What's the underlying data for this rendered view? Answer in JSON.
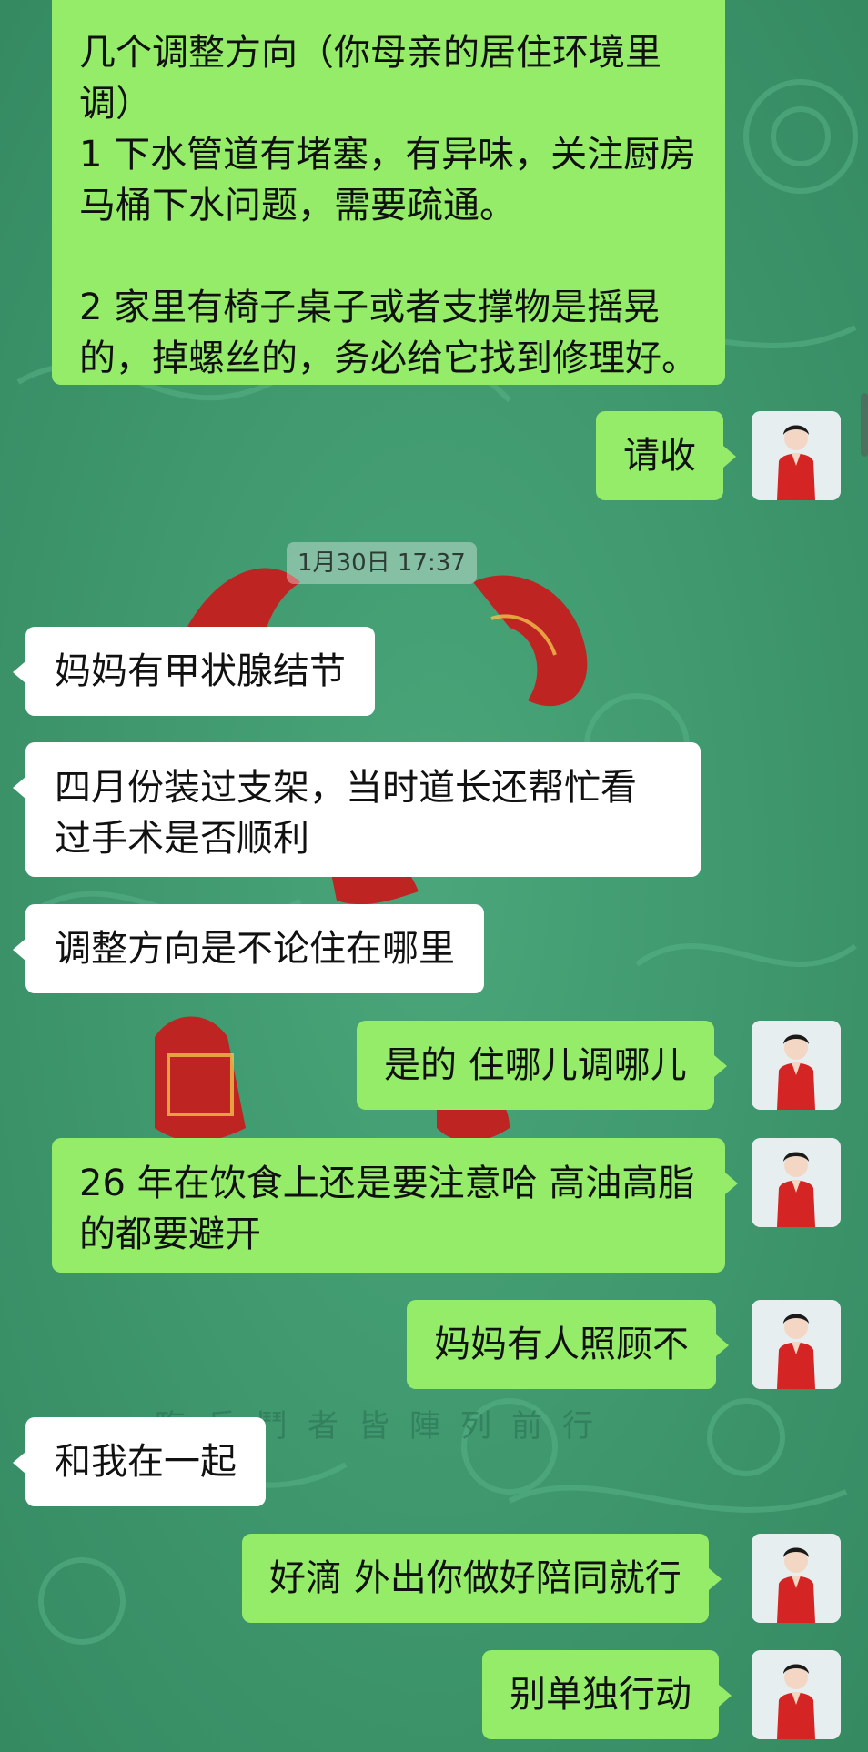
{
  "theme": {
    "background": "#3f9a6e",
    "outgoing_bubble": "#95ec69",
    "incoming_bubble": "#ffffff",
    "accent_red": "#c41e1e"
  },
  "conversation": {
    "timestamp": "1月30日 17:37",
    "messages": [
      {
        "side": "out",
        "text": "几个调整方向（你母亲的居住环境里调）\n1 下水管道有堵塞，有异味，关注厨房马桶下水问题，需要疏通。\n\n2 家里有椅子桌子或者支撑物是摇晃的，掉螺丝的，务必给它找到修理好。"
      },
      {
        "side": "out",
        "text": "请收"
      },
      {
        "side": "in",
        "text": "妈妈有甲状腺结节"
      },
      {
        "side": "in",
        "text": "四月份装过支架，当时道长还帮忙看过手术是否顺利"
      },
      {
        "side": "in",
        "text": "调整方向是不论住在哪里"
      },
      {
        "side": "out",
        "text": "是的 住哪儿调哪儿"
      },
      {
        "side": "out",
        "text": "26 年在饮食上还是要注意哈 高油高脂的都要避开"
      },
      {
        "side": "out",
        "text": "妈妈有人照顾不"
      },
      {
        "side": "in",
        "text": "和我在一起"
      },
      {
        "side": "out",
        "text": "好滴 外出你做好陪同就行"
      },
      {
        "side": "out",
        "text": "别单独行动"
      }
    ]
  },
  "background_art": {
    "watermark": "臨兵鬥者皆陣列前行"
  }
}
